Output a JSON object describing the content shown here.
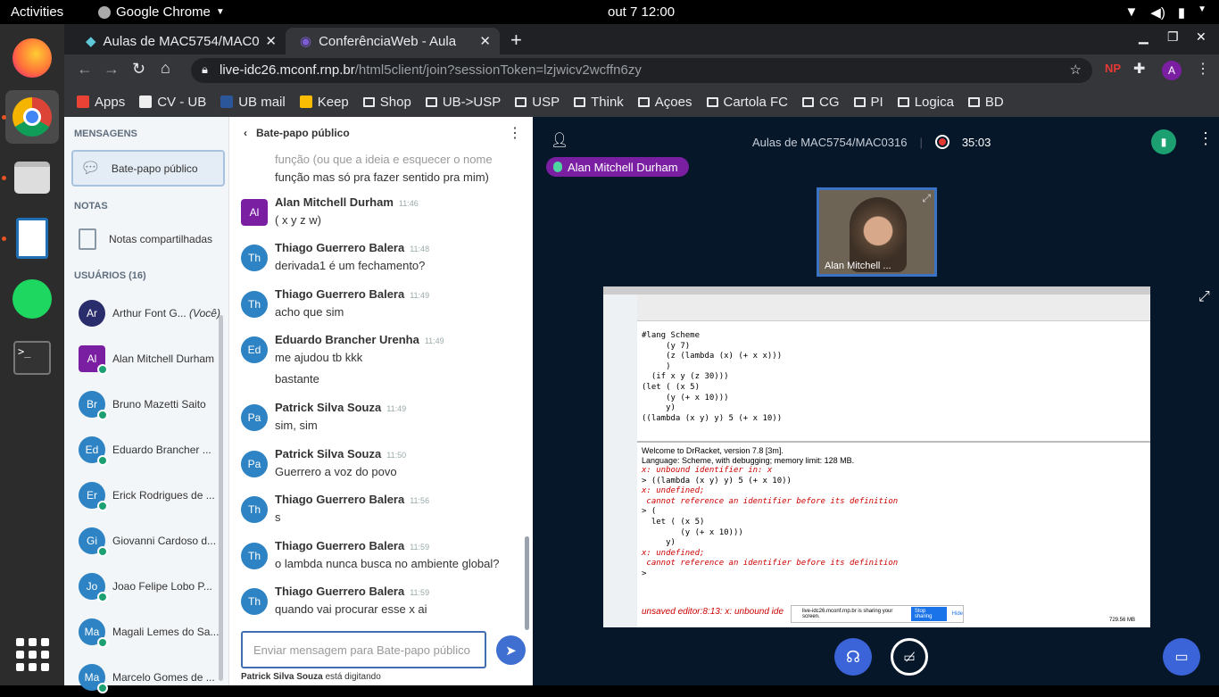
{
  "topbar": {
    "activities": "Activities",
    "app": "Google Chrome",
    "clock": "out 7  12:00"
  },
  "tabs": [
    {
      "label": "Aulas de MAC5754/MAC0",
      "active": false
    },
    {
      "label": "ConferênciaWeb - Aula",
      "active": true
    }
  ],
  "omnibox": {
    "host": "live-idc26.mconf.rnp.br",
    "path": "/html5client/join?sessionToken=lzjwicv2wcffn6zy"
  },
  "bookmarks": [
    {
      "label": "Apps",
      "icon": "apps-icon"
    },
    {
      "label": "CV - UB",
      "icon": "cv-icon"
    },
    {
      "label": "UB mail",
      "icon": "word-icon"
    },
    {
      "label": "Keep",
      "icon": "keep-icon"
    },
    {
      "label": "Shop",
      "icon": "folder-icon"
    },
    {
      "label": "UB->USP",
      "icon": "folder-icon"
    },
    {
      "label": "USP",
      "icon": "folder-icon"
    },
    {
      "label": "Think",
      "icon": "folder-icon"
    },
    {
      "label": "Açoes",
      "icon": "folder-icon"
    },
    {
      "label": "Cartola FC",
      "icon": "folder-icon"
    },
    {
      "label": "CG",
      "icon": "folder-icon"
    },
    {
      "label": "PI",
      "icon": "folder-icon"
    },
    {
      "label": "Logica",
      "icon": "folder-icon"
    },
    {
      "label": "BD",
      "icon": "folder-icon"
    }
  ],
  "sidebar": {
    "messages_title": "MENSAGENS",
    "public_chat": "Bate-papo público",
    "notes_title": "NOTAS",
    "shared_notes": "Notas compartilhadas",
    "users_title": "USUÁRIOS (16)",
    "users": [
      {
        "initials": "Ar",
        "name": "Arthur Font G...",
        "suffix": "(Você)",
        "color": "#2a2d6b"
      },
      {
        "initials": "Al",
        "name": "Alan Mitchell Durham",
        "suffix": "",
        "color": "#7b1fa2"
      },
      {
        "initials": "Br",
        "name": "Bruno Mazetti Saito",
        "suffix": "",
        "color": "#2d83c3"
      },
      {
        "initials": "Ed",
        "name": "Eduardo Brancher ...",
        "suffix": "",
        "color": "#2d83c3"
      },
      {
        "initials": "Er",
        "name": "Erick Rodrigues de ...",
        "suffix": "",
        "color": "#2d83c3"
      },
      {
        "initials": "Gi",
        "name": "Giovanni Cardoso d...",
        "suffix": "",
        "color": "#2d83c3"
      },
      {
        "initials": "Jo",
        "name": "Joao Felipe Lobo P...",
        "suffix": "",
        "color": "#2d83c3"
      },
      {
        "initials": "Ma",
        "name": "Magali Lemes do Sa...",
        "suffix": "",
        "color": "#2d83c3"
      },
      {
        "initials": "Ma",
        "name": "Marcelo Gomes de ...",
        "suffix": "",
        "color": "#2d83c3"
      }
    ]
  },
  "chat": {
    "title": "Bate-papo público",
    "partial": [
      "função (ou que a ideia e esquecer o nome",
      "função mas só pra fazer sentido pra mim)"
    ],
    "messages": [
      {
        "initials": "Al",
        "name": "Alan Mitchell Durham",
        "time": "11:46",
        "lines": [
          "( x y z w)"
        ],
        "color": "#7b1fa2"
      },
      {
        "initials": "Th",
        "name": "Thiago Guerrero Balera",
        "time": "11:48",
        "lines": [
          "derivada1 é um fechamento?"
        ],
        "color": "#2d83c3"
      },
      {
        "initials": "Th",
        "name": "Thiago Guerrero Balera",
        "time": "11:49",
        "lines": [
          "acho que sim"
        ],
        "color": "#2d83c3"
      },
      {
        "initials": "Ed",
        "name": "Eduardo Brancher Urenha",
        "time": "11:49",
        "lines": [
          "me ajudou tb kkk",
          "bastante"
        ],
        "color": "#2d83c3"
      },
      {
        "initials": "Pa",
        "name": "Patrick Silva Souza",
        "time": "11:49",
        "lines": [
          "sim, sim"
        ],
        "color": "#2d83c3"
      },
      {
        "initials": "Pa",
        "name": "Patrick Silva Souza",
        "time": "11:50",
        "lines": [
          "Guerrero a voz do povo"
        ],
        "color": "#2d83c3"
      },
      {
        "initials": "Th",
        "name": "Thiago Guerrero Balera",
        "time": "11:56",
        "lines": [
          "s"
        ],
        "color": "#2d83c3"
      },
      {
        "initials": "Th",
        "name": "Thiago Guerrero Balera",
        "time": "11:59",
        "lines": [
          "o lambda nunca busca no ambiente global?"
        ],
        "color": "#2d83c3"
      },
      {
        "initials": "Th",
        "name": "Thiago Guerrero Balera",
        "time": "11:59",
        "lines": [
          "quando vai procurar esse x ai"
        ],
        "color": "#2d83c3"
      }
    ],
    "input_placeholder": "Enviar mensagem para Bate-papo público",
    "typing_user": "Patrick Silva Souza",
    "typing_suffix": "está digitando"
  },
  "meeting": {
    "title": "Aulas de MAC5754/MAC0316",
    "timer": "35:03",
    "talker": "Alan Mitchell Durham",
    "webcam_name": "Alan Mitchell ..."
  },
  "slide": {
    "editor_lines": [
      "#lang Scheme",
      "     (y 7)",
      "     (z (lambda (x) (+ x x)))",
      "     )",
      "  (if x y (z 30)))",
      "(let ( (x 5)",
      "     (y (+ x 10)))",
      "     y)",
      "((lambda (x y) y) 5 (+ x 10))"
    ],
    "repl_welcome": "Welcome to DrRacket, version 7.8 [3m].",
    "repl_language": "Language: Scheme, with debugging; memory limit: 128 MB.",
    "repl_lines": [
      {
        "t": "x: unbound identifier in: x",
        "err": true
      },
      {
        "t": "> ((lambda (x y) y) 5 (+ x 10))",
        "err": false
      },
      {
        "t": "x: undefined;",
        "err": true
      },
      {
        "t": " cannot reference an identifier before its definition",
        "err": true
      },
      {
        "t": "> (",
        "err": false
      },
      {
        "t": "  let ( (x 5)",
        "err": false
      },
      {
        "t": "        (y (+ x 10)))",
        "err": false
      },
      {
        "t": "     y)",
        "err": false
      },
      {
        "t": "x: undefined;",
        "err": true
      },
      {
        "t": " cannot reference an identifier before its definition",
        "err": true
      },
      {
        "t": ">",
        "err": false
      }
    ],
    "status": "unsaved editor:8:13: x: unbound ide",
    "share_text": "live-idc26.mconf.rnp.br is sharing your screen.",
    "stop_sharing": "Stop sharing",
    "hide": "Hide",
    "memory": "729.56 MB"
  }
}
